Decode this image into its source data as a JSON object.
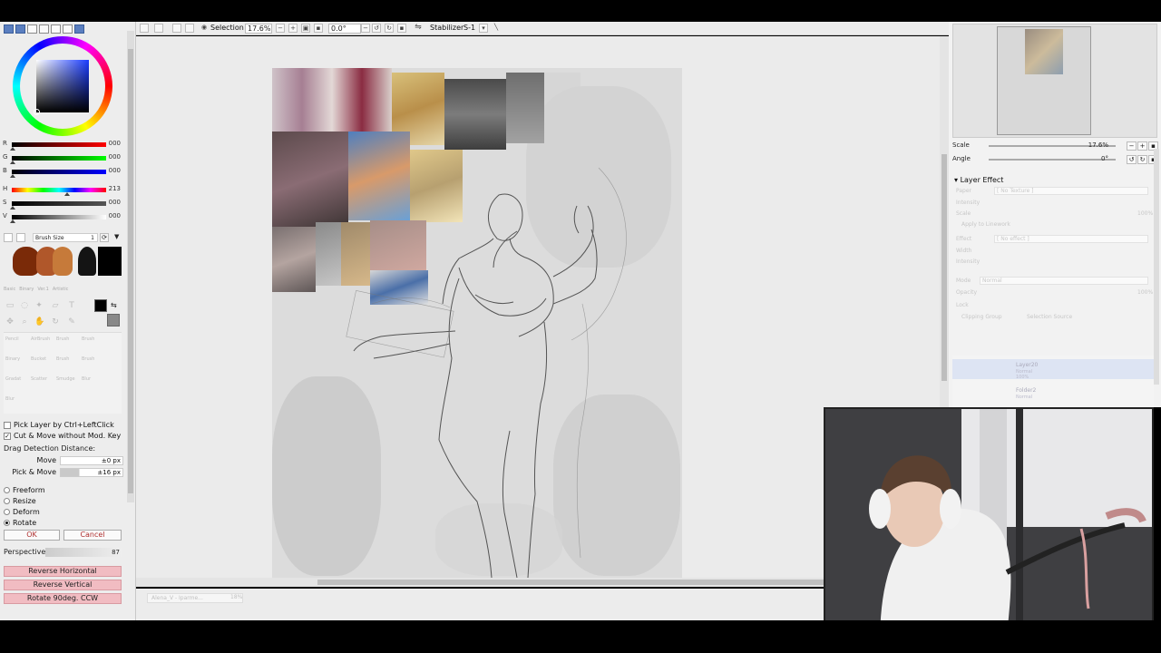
{
  "toolbar": {
    "selection_label": "Selection",
    "zoom_value": "17.6%",
    "angle_value": "0.0°",
    "stabilizer_label": "Stabilizer",
    "stabilizer_value": "S-1"
  },
  "color_panel": {
    "r_label": "R",
    "r_value": "000",
    "g_label": "G",
    "g_value": "000",
    "b_label": "B",
    "b_value": "000",
    "h_label": "H",
    "h_value": "213",
    "s_label": "S",
    "s_value": "000",
    "v_label": "V",
    "v_value": "000"
  },
  "brush": {
    "size_label": "Brush Size",
    "size_value": "1"
  },
  "tool_tabs": [
    "Basic",
    "Binary",
    "Ver.1",
    "Artistic"
  ],
  "brush_grid": [
    "Pencil",
    "AirBrush",
    "Brush",
    "Brush",
    "Binary",
    "Bucket",
    "Brush",
    "Brush",
    "Gradat",
    "Scatter",
    "Smudge",
    "Blur",
    "Blur"
  ],
  "transform_panel": {
    "pick_layer_label": "Pick Layer by Ctrl+LeftClick",
    "cut_move_label": "Cut & Move without Mod. Key",
    "drag_label": "Drag Detection Distance:",
    "move_label": "Move",
    "move_value": "±0 px",
    "pick_move_label": "Pick & Move",
    "pick_move_value": "±16 px",
    "modes": [
      "Freeform",
      "Resize",
      "Deform",
      "Rotate"
    ],
    "selected_mode": "Rotate",
    "ok_label": "OK",
    "cancel_label": "Cancel",
    "perspective_label": "Perspective",
    "perspective_value": "87",
    "reverse_h_label": "Reverse Horizontal",
    "reverse_v_label": "Reverse Vertical",
    "rotate_ccw_label": "Rotate 90deg. CCW"
  },
  "status": {
    "file_tab": "Alena_V - Iparme...",
    "zoom": "18%"
  },
  "navigator": {
    "scale_label": "Scale",
    "scale_value": "17.6%",
    "angle_label": "Angle",
    "angle_value": "0°"
  },
  "layer_effect": {
    "header": "Layer Effect",
    "paper_label": "Paper",
    "paper_value": "[ No Texture ]",
    "intensity_label": "Intensity",
    "scale_label": "Scale",
    "scale_value": "100%",
    "apply_label": "Apply to Linework",
    "effect_label": "Effect",
    "effect_value": "[ No effect ]",
    "width_label": "Width",
    "effect_intensity_label": "Intensity",
    "mode_label": "Mode",
    "mode_value": "Normal",
    "opacity_label": "Opacity",
    "opacity_value": "100%",
    "lock_label": "Lock",
    "clipping_label": "Clipping Group",
    "selection_source_label": "Selection Source"
  },
  "layers": [
    {
      "name": "Layer20",
      "blend": "Normal",
      "opacity": "100%"
    },
    {
      "name": "Folder2",
      "blend": "Normal",
      "opacity": ""
    }
  ],
  "colors": {
    "accent": "#5b7fc0",
    "pink_button": "#f1bcc2",
    "fg_color": "#000000",
    "bg_color": "#888888"
  }
}
